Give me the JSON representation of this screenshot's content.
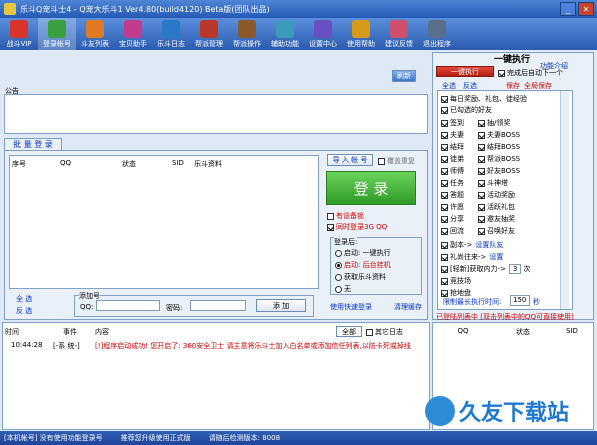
{
  "window": {
    "title": "乐斗Q宠斗士4 - Q宠大乐斗1 Ver4.80(build4120) Beta版(团队出品)"
  },
  "toolbar": {
    "items": [
      {
        "label": "战斗VIP",
        "color": "#d9342b"
      },
      {
        "label": "登录帐号",
        "color": "#3aa040"
      },
      {
        "label": "斗友列表",
        "color": "#e07a22"
      },
      {
        "label": "宝贝助手",
        "color": "#c23b8e"
      },
      {
        "label": "乐斗日志",
        "color": "#2a78c8"
      },
      {
        "label": "帮派管理",
        "color": "#b8392a"
      },
      {
        "label": "帮派操作",
        "color": "#8a5a2b"
      },
      {
        "label": "辅助功能",
        "color": "#3a9cb8"
      },
      {
        "label": "设置中心",
        "color": "#6a4fc2"
      },
      {
        "label": "使用帮助",
        "color": "#d69a1a"
      },
      {
        "label": "建议反馈",
        "color": "#cf4f6e"
      },
      {
        "label": "退出程序",
        "color": "#5a6f8c"
      }
    ]
  },
  "notice": {
    "refresh": "刷新",
    "title": "公告"
  },
  "batch": {
    "tab": "批 量 登 录",
    "columns": [
      "序号",
      "QQ",
      "状态",
      "SID",
      "乐斗资料"
    ],
    "import": "导 入 帐 号",
    "cover_repeat": "覆盖重复",
    "login": "登 录",
    "has_backup": "有设备锁",
    "sync_3g": "同时登录3G QQ",
    "after_login_title": "登录后:",
    "after_login_options": [
      "启动: 一键执行",
      "启动: 后台挂机",
      "获取乐斗资料",
      "无"
    ],
    "use_quick": "使用快速登录",
    "clear_cache": "清理缓存",
    "select_all": "全 选",
    "invert": "反 选",
    "add_title": "添加号",
    "qq_label": "QQ:",
    "pwd_label": "密码:",
    "add_btn": "添 加"
  },
  "onekey": {
    "title": "一键执行",
    "func_intro": "功能介绍",
    "run_btn": "一键执行",
    "auto_next": "完成后自动下一个",
    "select_all": "全选",
    "invert": "反选",
    "save": "保存",
    "save_all": "全局保存",
    "items": [
      {
        "label": "每日奖励、礼包、徒经验",
        "checked": true
      },
      {
        "label": "已勾选的好友",
        "checked": true
      },
      {
        "label": "签到",
        "checked": true
      },
      {
        "label": "抽/领奖",
        "checked": true
      },
      {
        "label": "夫妻",
        "checked": true
      },
      {
        "label": "夫妻BOSS",
        "checked": true
      },
      {
        "label": "结拜",
        "checked": true
      },
      {
        "label": "结拜BOSS",
        "checked": true
      },
      {
        "label": "徒弟",
        "checked": true
      },
      {
        "label": "帮派BOSS",
        "checked": true
      },
      {
        "label": "师傅",
        "checked": true
      },
      {
        "label": "好友BOSS",
        "checked": true
      },
      {
        "label": "任务",
        "checked": true
      },
      {
        "label": "斗神塔",
        "checked": true
      },
      {
        "label": "答题",
        "checked": true
      },
      {
        "label": "活动奖励",
        "checked": true
      },
      {
        "label": "许愿",
        "checked": true
      },
      {
        "label": "活跃礼包",
        "checked": true
      },
      {
        "label": "分享",
        "checked": true
      },
      {
        "label": "邀友抽奖",
        "checked": true
      },
      {
        "label": "回流",
        "checked": true
      },
      {
        "label": "召唤好友",
        "checked": true
      }
    ],
    "more": [
      {
        "label": "副本->",
        "link": "设置队友",
        "checked": true
      },
      {
        "label": "礼尚往来->",
        "link": "设置",
        "checked": true
      },
      {
        "label": "[轻新]获取内力->",
        "value": "3",
        "unit": "次",
        "checked": true
      },
      {
        "label": "竞技场",
        "checked": true
      },
      {
        "label": "抢地盘",
        "checked": true
      }
    ],
    "limit_label": "限制最长执行时间:",
    "limit_value": "150",
    "limit_unit": "秒",
    "logged_info": "已登陆列表中 [双击列表中的QQ可直接使用]"
  },
  "log": {
    "columns": [
      "时间",
      "事件",
      "内容"
    ],
    "filter": "全部",
    "other_logs": "其它日志",
    "row_time": "10:44:28",
    "row_event": "[-系 统-]",
    "row_content": "[!]程序启动成功! 您开启了: 360安全卫士 请主意将乐斗士加入白名单或添加信任列表,以防卡死或掉线"
  },
  "right_list": {
    "columns": [
      "QQ",
      "状态",
      "SID"
    ]
  },
  "status": {
    "left": "[本机帐号] 没有使用功能登录号",
    "middle": "推荐您升级使用正式版",
    "right": "请随后检测版本: 8008"
  },
  "watermark": {
    "text": "久友下载站"
  }
}
